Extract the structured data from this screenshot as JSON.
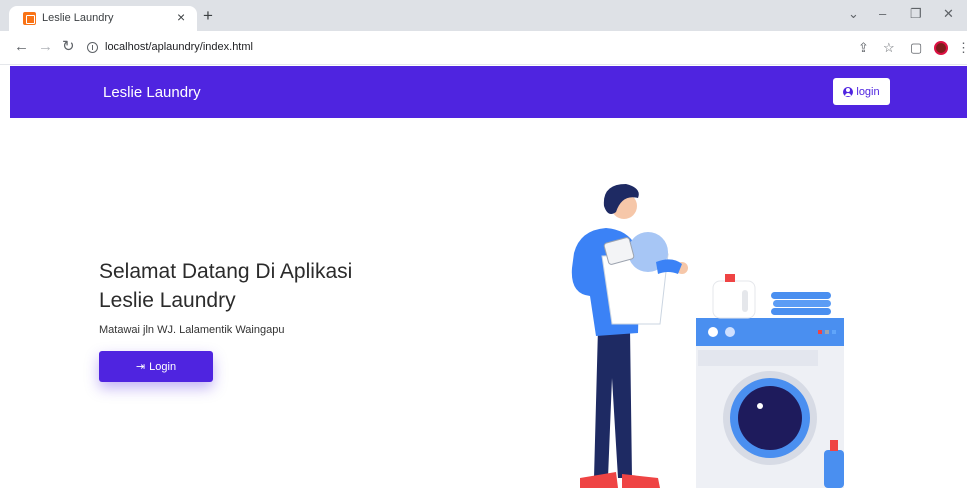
{
  "browser": {
    "tab_title": "Leslie Laundry",
    "tab_close": "×",
    "new_tab": "+",
    "url": "localhost/aplaundry/index.html",
    "window_controls": {
      "dropdown": "⌄",
      "minimize": "–",
      "restore": "❐",
      "close": "✕"
    },
    "toolbar_icons": [
      "share-icon",
      "bookmark-star-icon",
      "sidepanel-icon",
      "profile-avatar-icon",
      "menu-icon"
    ]
  },
  "navbar": {
    "brand": "Leslie Laundry",
    "login_label": "login",
    "accent_color": "#4f24e0"
  },
  "hero": {
    "title_line1": "Selamat Datang Di Aplikasi",
    "title_line2": "Leslie Laundry",
    "subtitle": "Matawai jln WJ. Lalamentik Waingapu",
    "login_label": "Login"
  },
  "illustration": {
    "description_icon": "laundry-woman-illustration"
  }
}
